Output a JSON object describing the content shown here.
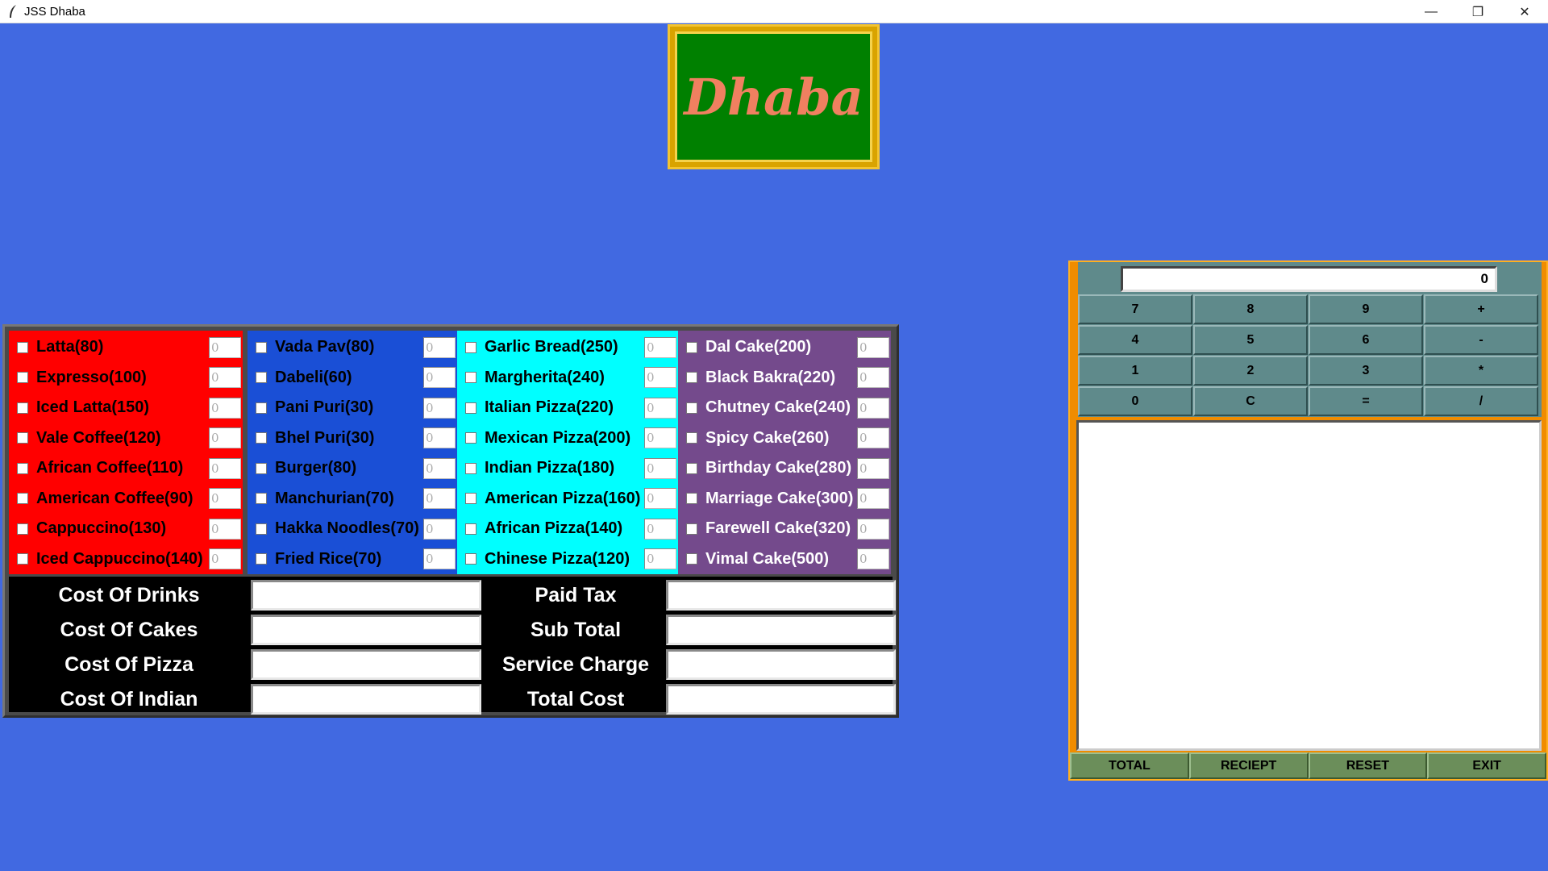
{
  "window": {
    "title": "JSS Dhaba",
    "minimize": "—",
    "maximize": "❐",
    "close": "✕"
  },
  "logo": {
    "text": "Dhaba"
  },
  "colors": {
    "background": "#4169e1",
    "drinks": "#ff0000",
    "indian": "#1a4fd6",
    "pizza": "#00ffff",
    "cakes": "#744a8c",
    "logo_green": "#008000",
    "logo_gold": "#d9a300",
    "calc_teal": "#5f8a8b",
    "action_green": "#6b8e5a",
    "calc_orange": "#f08c00"
  },
  "menu": {
    "drinks": [
      {
        "label": "Latta(80)",
        "qty": "0"
      },
      {
        "label": "Expresso(100)",
        "qty": "0"
      },
      {
        "label": "Iced Latta(150)",
        "qty": "0"
      },
      {
        "label": "Vale Coffee(120)",
        "qty": "0"
      },
      {
        "label": "African Coffee(110)",
        "qty": "0"
      },
      {
        "label": "American Coffee(90)",
        "qty": "0"
      },
      {
        "label": "Cappuccino(130)",
        "qty": "0"
      },
      {
        "label": "Iced Cappuccino(140)",
        "qty": "0"
      }
    ],
    "indian": [
      {
        "label": "Vada Pav(80)",
        "qty": "0"
      },
      {
        "label": "Dabeli(60)",
        "qty": "0"
      },
      {
        "label": "Pani Puri(30)",
        "qty": "0"
      },
      {
        "label": "Bhel Puri(30)",
        "qty": "0"
      },
      {
        "label": "Burger(80)",
        "qty": "0"
      },
      {
        "label": "Manchurian(70)",
        "qty": "0"
      },
      {
        "label": "Hakka Noodles(70)",
        "qty": "0"
      },
      {
        "label": "Fried Rice(70)",
        "qty": "0"
      }
    ],
    "pizza": [
      {
        "label": "Garlic Bread(250)",
        "qty": "0"
      },
      {
        "label": "Margherita(240)",
        "qty": "0"
      },
      {
        "label": "Italian Pizza(220)",
        "qty": "0"
      },
      {
        "label": "Mexican Pizza(200)",
        "qty": "0"
      },
      {
        "label": "Indian Pizza(180)",
        "qty": "0"
      },
      {
        "label": "American Pizza(160)",
        "qty": "0"
      },
      {
        "label": "African Pizza(140)",
        "qty": "0"
      },
      {
        "label": "Chinese Pizza(120)",
        "qty": "0"
      }
    ],
    "cakes": [
      {
        "label": "Dal Cake(200)",
        "qty": "0"
      },
      {
        "label": "Black Bakra(220)",
        "qty": "0"
      },
      {
        "label": "Chutney Cake(240)",
        "qty": "0"
      },
      {
        "label": "Spicy Cake(260)",
        "qty": "0"
      },
      {
        "label": "Birthday Cake(280)",
        "qty": "0"
      },
      {
        "label": "Marriage Cake(300)",
        "qty": "0"
      },
      {
        "label": "Farewell Cake(320)",
        "qty": "0"
      },
      {
        "label": "Vimal Cake(500)",
        "qty": "0"
      }
    ]
  },
  "costs": {
    "left": [
      "Cost Of Drinks",
      "Cost Of Cakes",
      "Cost Of Pizza",
      "Cost Of Indian"
    ],
    "right": [
      "Paid Tax",
      "Sub Total",
      "Service Charge",
      "Total Cost"
    ]
  },
  "calculator": {
    "display": "0",
    "keys": [
      "7",
      "8",
      "9",
      "+",
      "4",
      "5",
      "6",
      "-",
      "1",
      "2",
      "3",
      "*",
      "0",
      "C",
      "=",
      "/"
    ]
  },
  "actions": [
    "TOTAL",
    "RECIEPT",
    "RESET",
    "EXIT"
  ]
}
